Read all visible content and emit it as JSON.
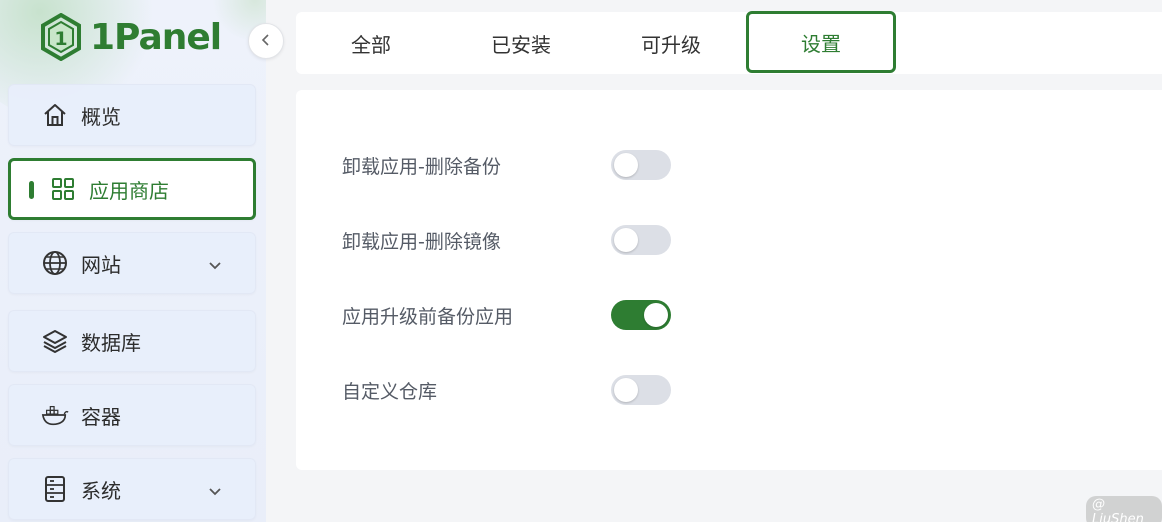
{
  "brand": {
    "name": "1Panel",
    "accent": "#2e7d32"
  },
  "sidebar": {
    "items": [
      {
        "label": "概览",
        "icon": "home-icon",
        "expandable": false
      },
      {
        "label": "应用商店",
        "icon": "grid-icon",
        "expandable": false,
        "active": true
      },
      {
        "label": "网站",
        "icon": "globe-icon",
        "expandable": true
      },
      {
        "label": "数据库",
        "icon": "layers-icon",
        "expandable": false
      },
      {
        "label": "容器",
        "icon": "docker-icon",
        "expandable": false
      },
      {
        "label": "系统",
        "icon": "server-icon",
        "expandable": true
      }
    ]
  },
  "tabs": [
    {
      "label": "全部"
    },
    {
      "label": "已安装"
    },
    {
      "label": "可升级"
    },
    {
      "label": "设置",
      "active": true
    }
  ],
  "settings": [
    {
      "label": "卸载应用-删除备份",
      "enabled": false
    },
    {
      "label": "卸载应用-删除镜像",
      "enabled": false
    },
    {
      "label": "应用升级前备份应用",
      "enabled": true
    },
    {
      "label": "自定义仓库",
      "enabled": false
    }
  ],
  "watermark": "@ LiuShen"
}
